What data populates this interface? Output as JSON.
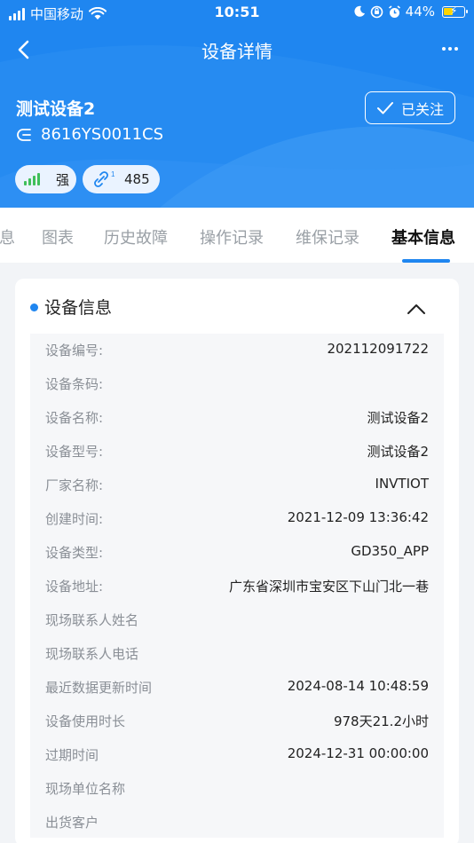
{
  "status_bar": {
    "carrier": "中国移动",
    "time": "10:51",
    "battery": "44%"
  },
  "nav": {
    "title": "设备详情",
    "back_icon": "chevron-left-icon",
    "more_icon": "more-horizontal-icon"
  },
  "device": {
    "name": "测试设备2",
    "sn": "8616YS0011CS",
    "follow_label": "已关注",
    "signal_label": "强",
    "link_value": "485",
    "link_superscript": "1"
  },
  "tabs": [
    {
      "label": "息"
    },
    {
      "label": "图表"
    },
    {
      "label": "历史故障"
    },
    {
      "label": "操作记录"
    },
    {
      "label": "维保记录"
    },
    {
      "label": "基本信息",
      "active": true
    }
  ],
  "section": {
    "title": "设备信息",
    "rows": [
      {
        "label": "设备编号:",
        "value": "202112091722"
      },
      {
        "label": "设备条码:",
        "value": ""
      },
      {
        "label": "设备名称:",
        "value": "测试设备2"
      },
      {
        "label": "设备型号:",
        "value": "测试设备2"
      },
      {
        "label": "厂家名称:",
        "value": "INVTIOT"
      },
      {
        "label": "创建时间:",
        "value": "2021-12-09 13:36:42"
      },
      {
        "label": "设备类型:",
        "value": "GD350_APP"
      },
      {
        "label": "设备地址:",
        "value": "广东省深圳市宝安区下山门北一巷"
      },
      {
        "label": "现场联系人姓名",
        "value": ""
      },
      {
        "label": "现场联系人电话",
        "value": ""
      },
      {
        "label": "最近数据更新时间",
        "value": "2024-08-14 10:48:59"
      },
      {
        "label": "设备使用时长",
        "value": "978天21.2小时"
      },
      {
        "label": "过期时间",
        "value": "2024-12-31 00:00:00"
      },
      {
        "label": "现场单位名称",
        "value": ""
      },
      {
        "label": "出货客户",
        "value": ""
      }
    ]
  },
  "colors": {
    "brand": "#1f86f0",
    "signal_green": "#3fbf5a",
    "battery_yellow": "#ffd400"
  }
}
